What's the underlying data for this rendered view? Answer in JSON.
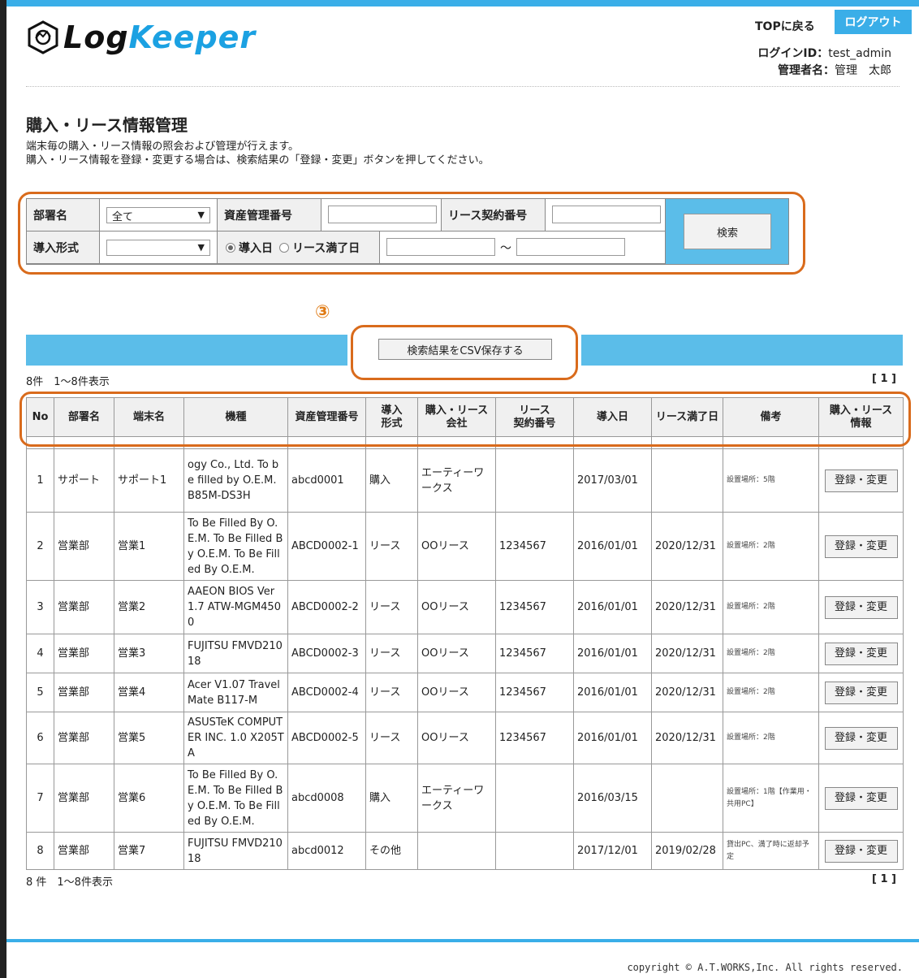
{
  "header": {
    "logo_text_a": "Log",
    "logo_text_b": "Keeper",
    "top_link": "TOPに戻る",
    "logout": "ログアウト",
    "login_id_label": "ログインID：",
    "login_id": "test_admin",
    "admin_label": "管理者名：",
    "admin_name": "管理　太郎"
  },
  "page": {
    "title": "購入・リース情報管理",
    "desc1": "端末毎の購入・リース情報の照会および管理が行えます。",
    "desc2": "購入・リース情報を登録・変更する場合は、検索結果の「登録・変更」ボタンを押してください。"
  },
  "search": {
    "dept_label": "部署名",
    "dept_value": "全て",
    "asset_label": "資産管理番号",
    "lease_label": "リース契約番号",
    "type_label": "導入形式",
    "type_value": "",
    "radio_intro": "導入日",
    "radio_expire": "リース満了日",
    "tilde": "～",
    "button": "検索"
  },
  "annotation_number": "③",
  "csv_button": "検索結果をCSV保存する",
  "count_text": "8件　1～8件表示",
  "count_text_bottom": "8 件　1～8件表示",
  "pager": "[ 1 ]",
  "table": {
    "headers": [
      "No",
      "部署名",
      "端末名",
      "機種",
      "資産管理番号",
      "導入\n形式",
      "購入・リース\n会社",
      "リース\n契約番号",
      "導入日",
      "リース満了日",
      "備考",
      "購入・リース\n情報"
    ],
    "register_label": "登録・変更",
    "rows": [
      {
        "no": "1",
        "dept": "サポート",
        "term": "サポート1",
        "model": "ogy Co., Ltd. To be filled by O.E.M. B85M-DS3H",
        "asset": "abcd0001",
        "type": "購入",
        "company": "エーティーワークス",
        "contract": "",
        "intro": "2017/03/01",
        "expire": "",
        "note": "設置場所：5階"
      },
      {
        "no": "2",
        "dept": "営業部",
        "term": "営業1",
        "model": "To Be Filled By O.E.M. To Be Filled By O.E.M. To Be Filled By O.E.M.",
        "asset": "ABCD0002-1",
        "type": "リース",
        "company": "OOリース",
        "contract": "1234567",
        "intro": "2016/01/01",
        "expire": "2020/12/31",
        "note": "設置場所：2階"
      },
      {
        "no": "3",
        "dept": "営業部",
        "term": "営業2",
        "model": "AAEON BIOS Ver 1.7 ATW-MGM4500",
        "asset": "ABCD0002-2",
        "type": "リース",
        "company": "OOリース",
        "contract": "1234567",
        "intro": "2016/01/01",
        "expire": "2020/12/31",
        "note": "設置場所：2階"
      },
      {
        "no": "4",
        "dept": "営業部",
        "term": "営業3",
        "model": "FUJITSU FMVD21018",
        "asset": "ABCD0002-3",
        "type": "リース",
        "company": "OOリース",
        "contract": "1234567",
        "intro": "2016/01/01",
        "expire": "2020/12/31",
        "note": "設置場所：2階"
      },
      {
        "no": "5",
        "dept": "営業部",
        "term": "営業4",
        "model": "Acer V1.07 TravelMate B117-M",
        "asset": "ABCD0002-4",
        "type": "リース",
        "company": "OOリース",
        "contract": "1234567",
        "intro": "2016/01/01",
        "expire": "2020/12/31",
        "note": "設置場所：2階"
      },
      {
        "no": "6",
        "dept": "営業部",
        "term": "営業5",
        "model": "ASUSTeK COMPUTER INC. 1.0 X205TA",
        "asset": "ABCD0002-5",
        "type": "リース",
        "company": "OOリース",
        "contract": "1234567",
        "intro": "2016/01/01",
        "expire": "2020/12/31",
        "note": "設置場所：2階"
      },
      {
        "no": "7",
        "dept": "営業部",
        "term": "営業6",
        "model": "To Be Filled By O.E.M. To Be Filled By O.E.M. To Be Filled By O.E.M.",
        "asset": "abcd0008",
        "type": "購入",
        "company": "エーティーワークス",
        "contract": "",
        "intro": "2016/03/15",
        "expire": "",
        "note": "設置場所：1階【作業用・共用PC】"
      },
      {
        "no": "8",
        "dept": "営業部",
        "term": "営業7",
        "model": "FUJITSU FMVD21018",
        "asset": "abcd0012",
        "type": "その他",
        "company": "",
        "contract": "",
        "intro": "2017/12/01",
        "expire": "2019/02/28",
        "note": "貸出PC、満了時に返却予定"
      }
    ]
  },
  "footer": {
    "copyright": "copyright © A.T.WORKS,Inc. All rights reserved."
  },
  "colors": {
    "accent": "#3aaee8",
    "panel_blue": "#5bbde9",
    "highlight": "#d96b1c"
  }
}
